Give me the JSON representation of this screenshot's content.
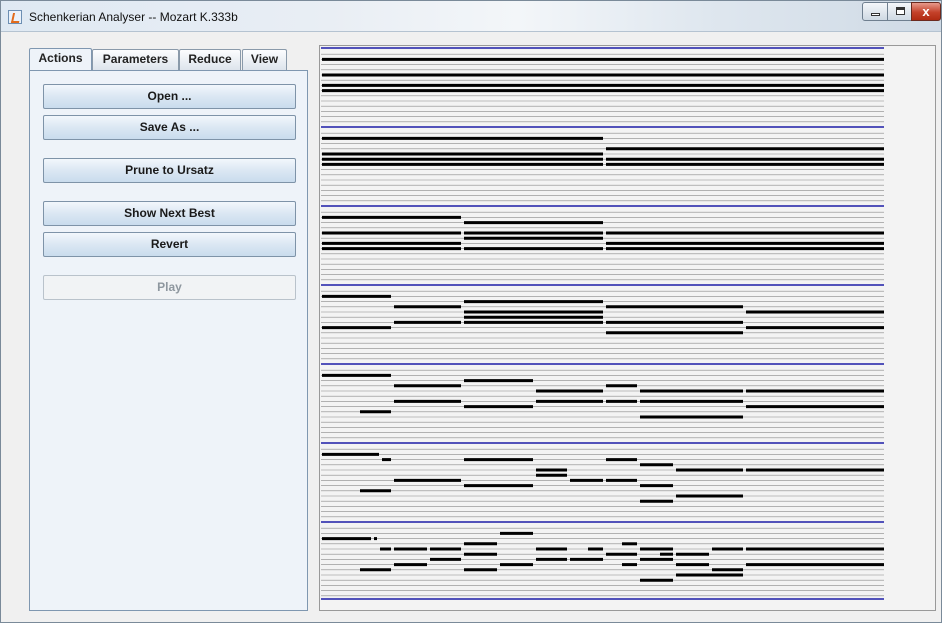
{
  "window": {
    "title": "Schenkerian Analyser -- Mozart K.333b",
    "close_glyph": "x",
    "controls": [
      "minimize-icon",
      "maximize-icon",
      "close-icon"
    ]
  },
  "tabs": [
    {
      "label": "Actions",
      "active": true
    },
    {
      "label": "Parameters",
      "active": false
    },
    {
      "label": "Reduce",
      "active": false
    },
    {
      "label": "View",
      "active": false
    }
  ],
  "actions": {
    "open_label": "Open ...",
    "save_as_label": "Save As ...",
    "prune_label": "Prune to Ursatz",
    "show_next_best_label": "Show Next Best",
    "revert_label": "Revert",
    "play_label": "Play",
    "play_enabled": false
  },
  "colors": {
    "level_separator": "#1c1ca8",
    "note": "#000000",
    "staff_line": "#8a8a8a"
  }
}
